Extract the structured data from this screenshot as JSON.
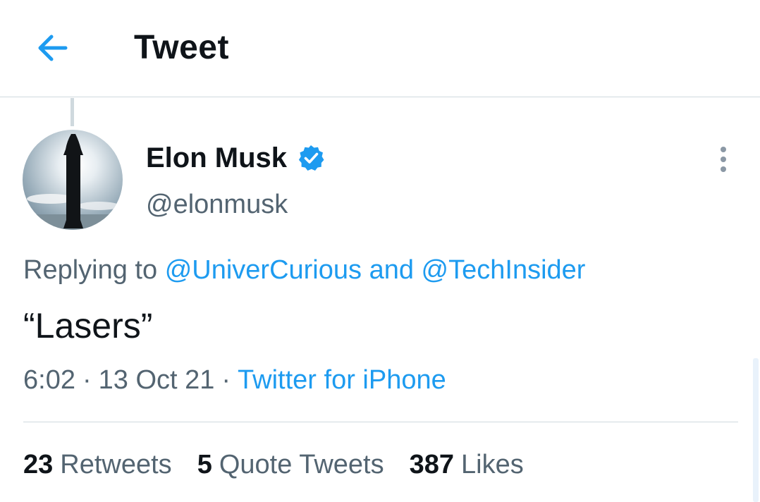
{
  "header": {
    "back_icon": "arrow-left-icon",
    "title": "Tweet"
  },
  "tweet": {
    "author": {
      "name": "Elon Musk",
      "handle": "@elonmusk",
      "verified": true,
      "verified_icon": "verified-badge-icon"
    },
    "more_icon": "more-vertical-icon",
    "replying": {
      "prefix": "Replying to",
      "mention_1": "@UniverCurious",
      "conjunction": "and",
      "mention_2": "@TechInsider"
    },
    "text": "“Lasers”",
    "time": "6:02",
    "date": "13 Oct 21",
    "separator": "·",
    "source": "Twitter for iPhone"
  },
  "stats": {
    "retweets": {
      "count": "23",
      "label": "Retweets"
    },
    "quotes": {
      "count": "5",
      "label": "Quote Tweets"
    },
    "likes": {
      "count": "387",
      "label": "Likes"
    }
  },
  "colors": {
    "accent": "#1d9bf0",
    "text_primary": "#0f1419",
    "text_secondary": "#536471",
    "border": "#cfd9de"
  }
}
